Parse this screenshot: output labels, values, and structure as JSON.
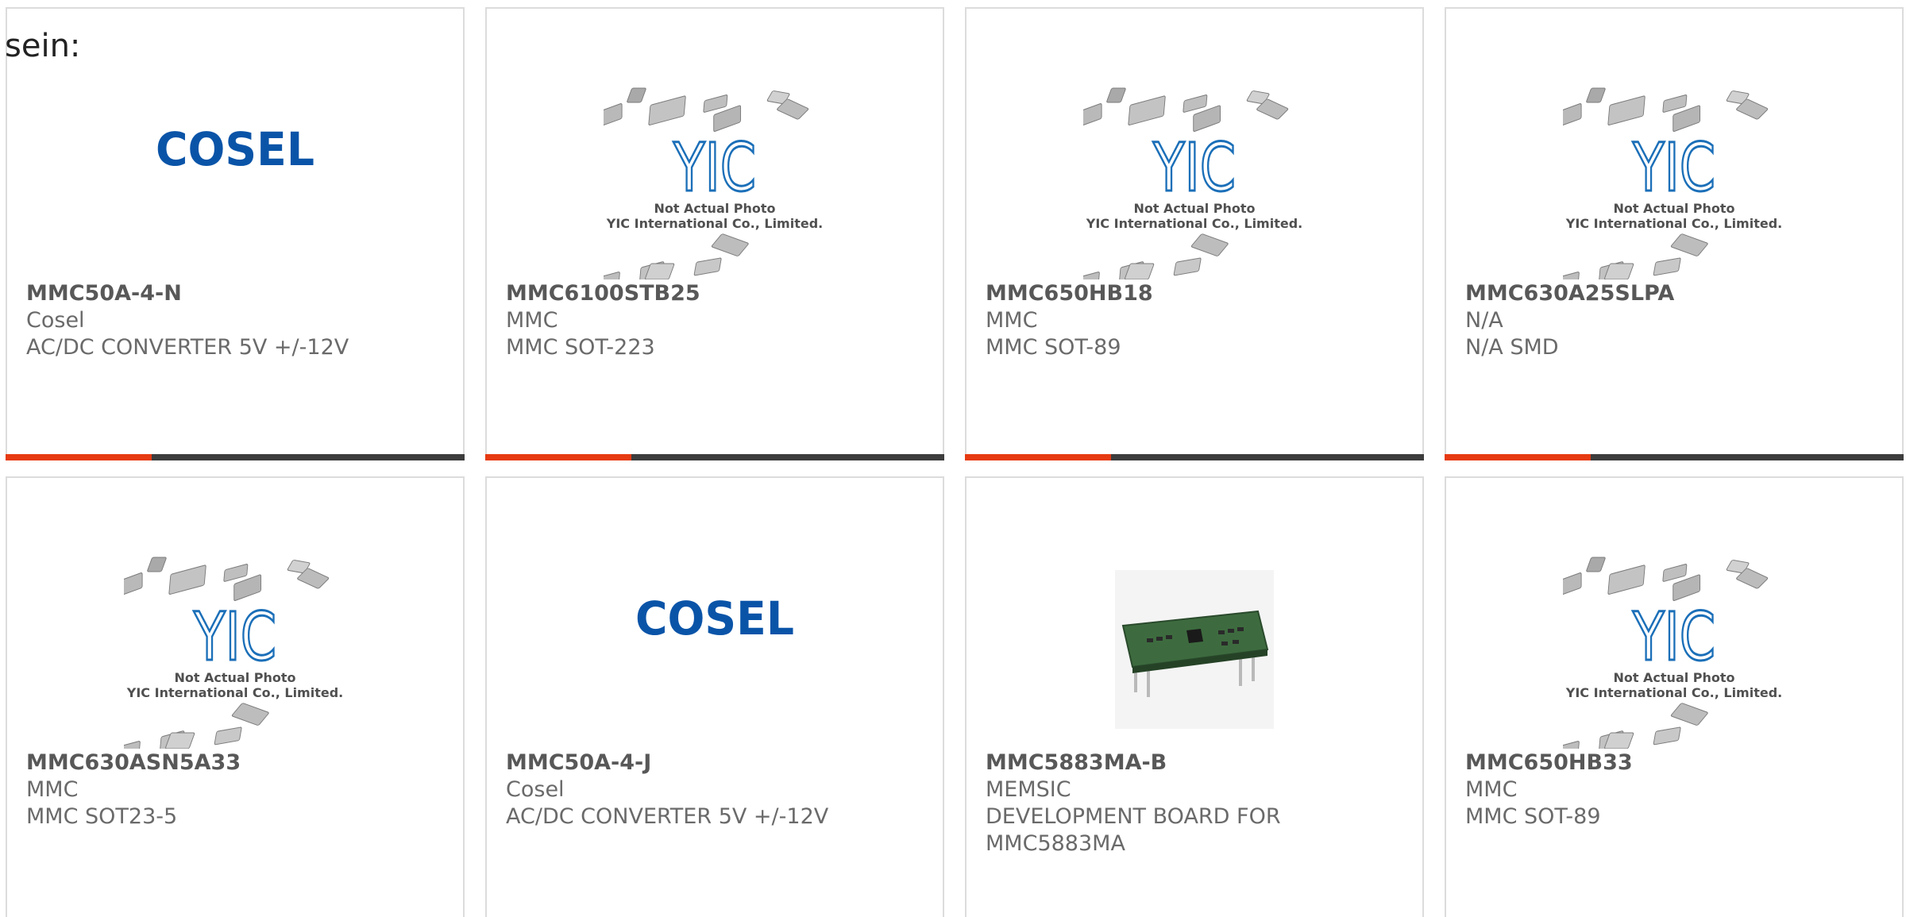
{
  "intro_text": "sein:",
  "colors": {
    "accent_bar": "#e63a12",
    "bar": "#3d3d3d",
    "cosel_blue": "#0a54a8",
    "yic_blue": "#1b6fb8"
  },
  "yic_placeholder": {
    "line1": "Not Actual Photo",
    "line2": "YIC International Co., Limited.",
    "logo_text": "YIC"
  },
  "cosel_logo_text": "COSEL",
  "products": [
    {
      "part_number": "MMC50A-4-N",
      "manufacturer": "Cosel",
      "description": "AC/DC CONVERTER 5V +/-12V",
      "image": "cosel-logo"
    },
    {
      "part_number": "MMC6100STB25",
      "manufacturer": "MMC",
      "description": "MMC SOT-223",
      "image": "yic-placeholder"
    },
    {
      "part_number": "MMC650HB18",
      "manufacturer": "MMC",
      "description": "MMC SOT-89",
      "image": "yic-placeholder"
    },
    {
      "part_number": "MMC630A25SLPA",
      "manufacturer": "N/A",
      "description": "N/A SMD",
      "image": "yic-placeholder"
    },
    {
      "part_number": "MMC630ASN5A33",
      "manufacturer": "MMC",
      "description": "MMC SOT23-5",
      "image": "yic-placeholder"
    },
    {
      "part_number": "MMC50A-4-J",
      "manufacturer": "Cosel",
      "description": "AC/DC CONVERTER 5V +/-12V",
      "image": "cosel-logo"
    },
    {
      "part_number": "MMC5883MA-B",
      "manufacturer": "MEMSIC",
      "description": "DEVELOPMENT BOARD FOR MMC5883MA",
      "image": "board-photo"
    },
    {
      "part_number": "MMC650HB33",
      "manufacturer": "MMC",
      "description": "MMC SOT-89",
      "image": "yic-placeholder"
    }
  ]
}
